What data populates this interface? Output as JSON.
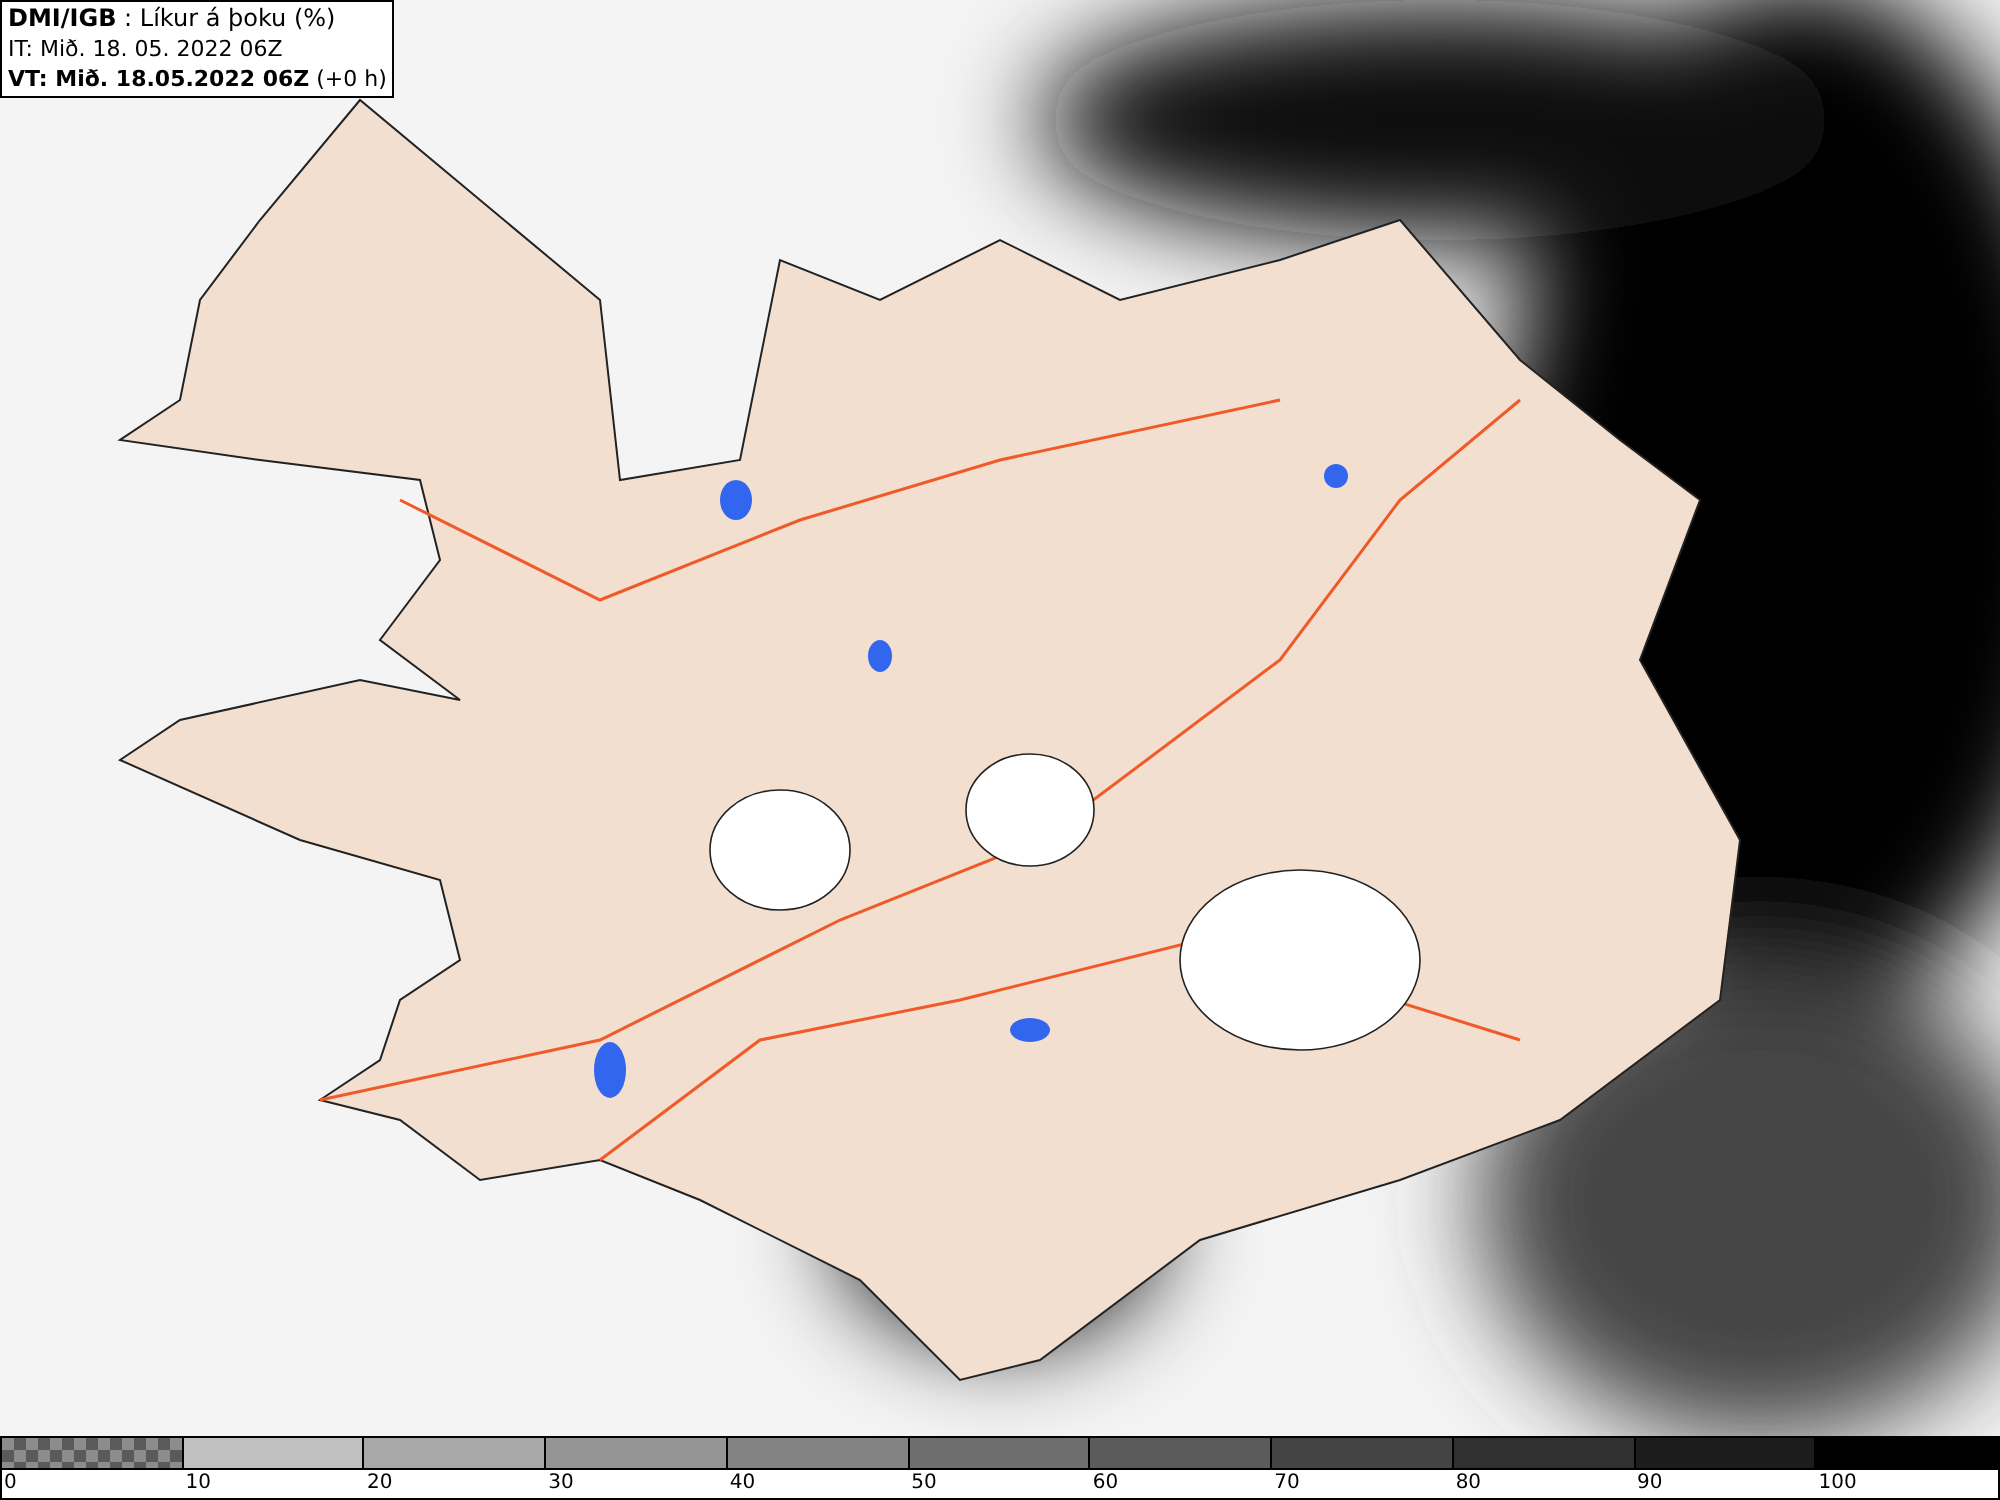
{
  "header": {
    "title": "**DMI/IGB** : Líkur á þoku (%)",
    "issue_time": "IT: Mið. 18. 05. 2022 06Z",
    "valid_time": "**VT: Mið. 18.05.2022 06Z** (+0 h)"
  },
  "legend": {
    "swatches": [
      {
        "kind": "checker",
        "color": "#8c8c8c"
      },
      {
        "kind": "solid",
        "color": "#c0c0c0"
      },
      {
        "kind": "solid",
        "color": "#a8a8a8"
      },
      {
        "kind": "solid",
        "color": "#959595"
      },
      {
        "kind": "solid",
        "color": "#838383"
      },
      {
        "kind": "solid",
        "color": "#6e6e6e"
      },
      {
        "kind": "solid",
        "color": "#5a5a5a"
      },
      {
        "kind": "solid",
        "color": "#444444"
      },
      {
        "kind": "solid",
        "color": "#303030"
      },
      {
        "kind": "solid",
        "color": "#1c1c1c"
      },
      {
        "kind": "solid",
        "color": "#000000"
      }
    ],
    "labels": [
      "0",
      "10",
      "20",
      "30",
      "40",
      "50",
      "60",
      "70",
      "80",
      "90",
      "100"
    ]
  }
}
